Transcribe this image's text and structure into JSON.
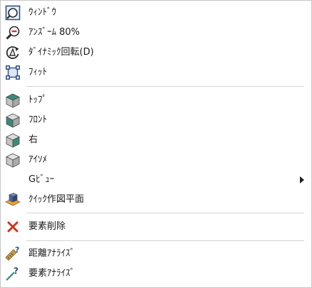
{
  "menu": {
    "items": [
      {
        "label": "ｳｨﾝﾄﾞｳ",
        "icon": "zoom-window-icon"
      },
      {
        "label": "ｱﾝｽﾞｰﾑ 80%",
        "icon": "zoom-out-icon"
      },
      {
        "label": "ﾀﾞｲﾅﾐｯｸ回転(D)",
        "icon": "dynamic-rotate-icon"
      },
      {
        "label": "ﾌｨｯﾄ",
        "icon": "fit-icon"
      },
      {
        "label": "ﾄｯﾌﾟ",
        "icon": "view-top-icon"
      },
      {
        "label": "ﾌﾛﾝﾄ",
        "icon": "view-front-icon"
      },
      {
        "label": "右",
        "icon": "view-right-icon"
      },
      {
        "label": "ｱｲｿﾒ",
        "icon": "view-iso-icon"
      },
      {
        "label": "Gﾋﾞｭｰ",
        "icon": "",
        "submenu": true
      },
      {
        "label": "ｸｲｯｸ作図平面",
        "icon": "quick-plane-icon"
      },
      {
        "label": "要素削除",
        "icon": "delete-x-icon"
      },
      {
        "label": "距離ｱﾅﾗｲｽﾞ",
        "icon": "distance-analyze-icon"
      },
      {
        "label": "要素ｱﾅﾗｲｽﾞ",
        "icon": "element-analyze-icon"
      }
    ]
  }
}
